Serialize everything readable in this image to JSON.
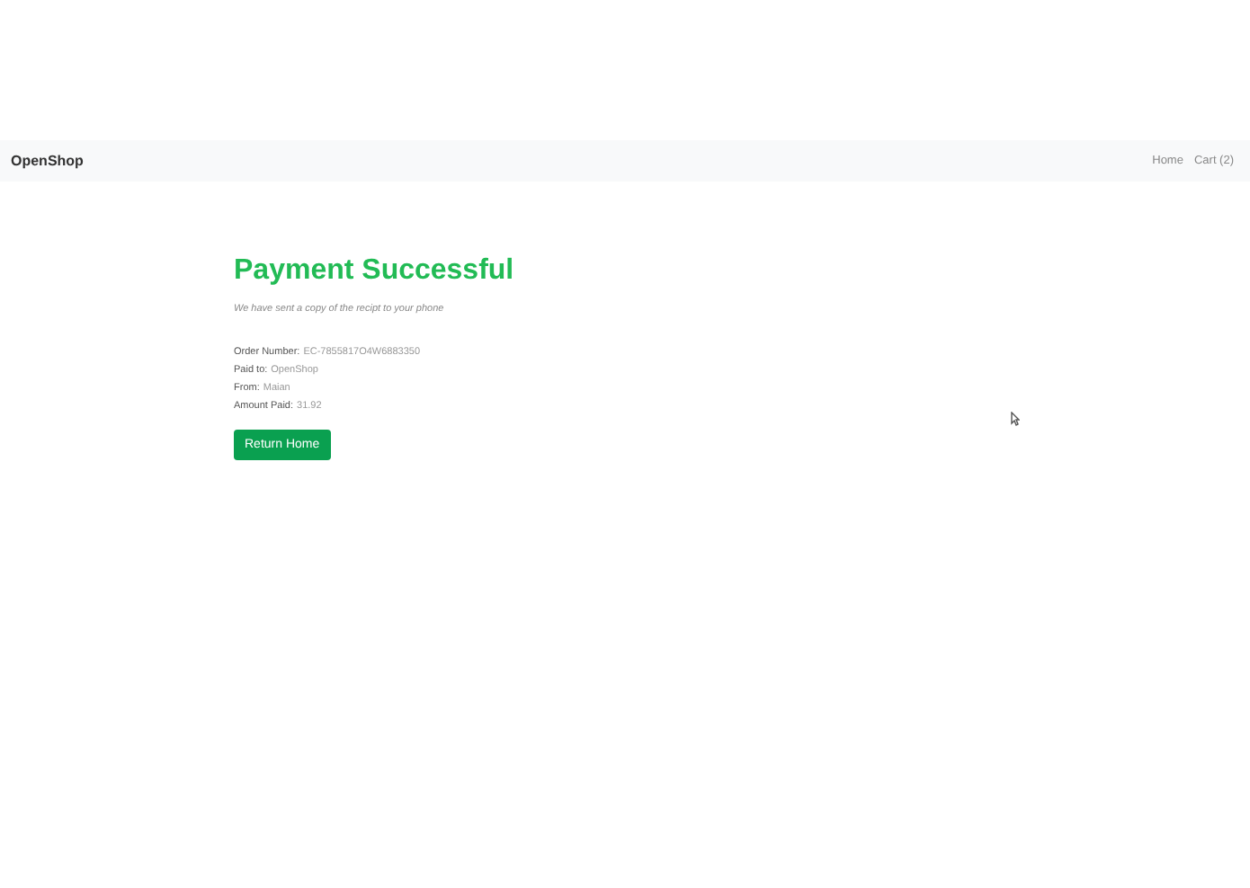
{
  "navbar": {
    "brand": "OpenShop",
    "links": [
      {
        "label": "Home"
      },
      {
        "label": "Cart (2)"
      }
    ]
  },
  "main": {
    "title": "Payment Successful",
    "subtitle": "We have sent a copy of the recipt to your phone",
    "details": [
      {
        "label": "Order Number:",
        "value": "EC-7855817O4W6883350"
      },
      {
        "label": "Paid to:",
        "value": "OpenShop"
      },
      {
        "label": "From:",
        "value": "Maian"
      },
      {
        "label": "Amount Paid:",
        "value": "31.92"
      }
    ],
    "button": "Return Home"
  }
}
